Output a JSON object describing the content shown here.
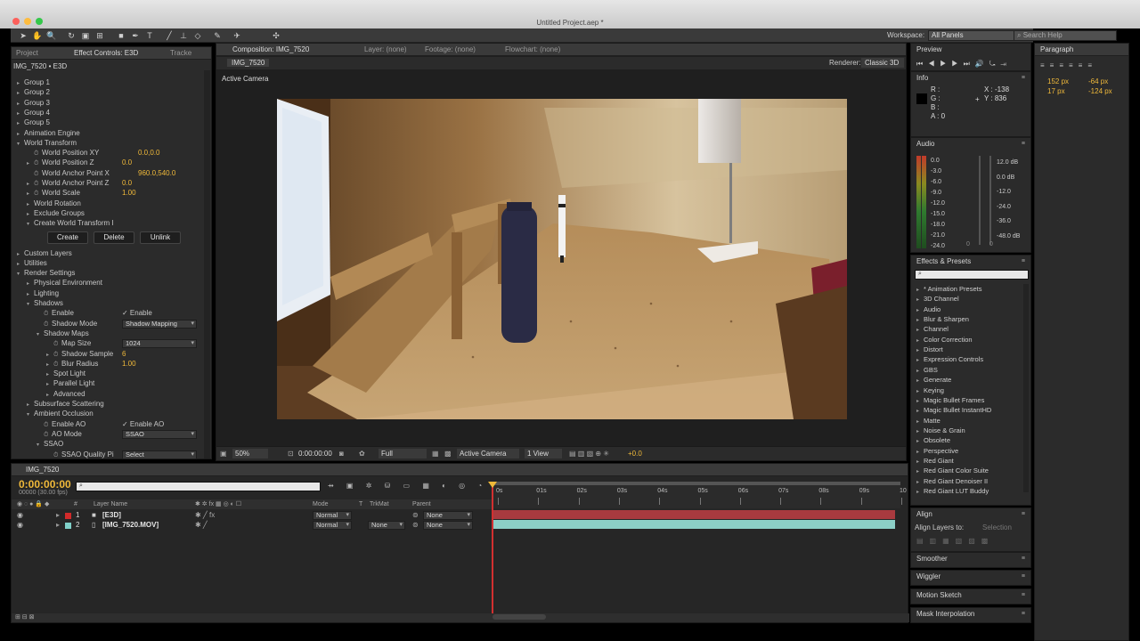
{
  "window": {
    "title": "Untitled Project.aep *"
  },
  "toolbar": {
    "workspace_label": "Workspace:",
    "workspace_value": "All Panels",
    "search_placeholder": "Search Help"
  },
  "left_panel": {
    "tabs": [
      "Project",
      "Effect Controls: E3D",
      "Tracke"
    ],
    "breadcrumb": "IMG_7520 • E3D",
    "rows": [
      {
        "label": "Group 1",
        "indent": 1,
        "tri": "▸"
      },
      {
        "label": "Group 2",
        "indent": 1,
        "tri": "▸"
      },
      {
        "label": "Group 3",
        "indent": 1,
        "tri": "▸"
      },
      {
        "label": "Group 4",
        "indent": 1,
        "tri": "▸"
      },
      {
        "label": "Group 5",
        "indent": 1,
        "tri": "▸"
      },
      {
        "label": "Animation Engine",
        "indent": 1,
        "tri": "▸"
      },
      {
        "label": "World Transform",
        "indent": 1,
        "tri": "▾"
      },
      {
        "label": "World Position XY",
        "indent": 2,
        "sw": true,
        "value": "0.0,0.0"
      },
      {
        "label": "World Position Z",
        "indent": 2,
        "tri": "▸",
        "sw": true,
        "value": "0.0"
      },
      {
        "label": "World Anchor Point X",
        "indent": 2,
        "sw": true,
        "value": "960.0,540.0"
      },
      {
        "label": "World Anchor Point Z",
        "indent": 2,
        "tri": "▸",
        "sw": true,
        "value": "0.0"
      },
      {
        "label": "World Scale",
        "indent": 2,
        "tri": "▸",
        "sw": true,
        "value": "1.00"
      },
      {
        "label": "World Rotation",
        "indent": 2,
        "tri": "▸"
      },
      {
        "label": "Exclude Groups",
        "indent": 2,
        "tri": "▸"
      },
      {
        "label": "Create World Transform I",
        "indent": 2,
        "tri": "▾"
      }
    ],
    "buttons": [
      "Create",
      "Delete",
      "Unlink"
    ],
    "rows2": [
      {
        "label": "Custom Layers",
        "indent": 1,
        "tri": "▸"
      },
      {
        "label": "Utilities",
        "indent": 1,
        "tri": "▸"
      },
      {
        "label": "Render Settings",
        "indent": 1,
        "tri": "▾"
      },
      {
        "label": "Physical Environment",
        "indent": 2,
        "tri": "▸"
      },
      {
        "label": "Lighting",
        "indent": 2,
        "tri": "▸"
      },
      {
        "label": "Shadows",
        "indent": 2,
        "tri": "▾"
      },
      {
        "label": "Enable",
        "indent": 3,
        "sw": true,
        "check": "✓ Enable"
      },
      {
        "label": "Shadow Mode",
        "indent": 3,
        "sw": true,
        "dropdown": "Shadow Mapping"
      },
      {
        "label": "Shadow Maps",
        "indent": 3,
        "tri": "▾"
      },
      {
        "label": "Map Size",
        "indent": 4,
        "sw": true,
        "dropdown": "1024"
      },
      {
        "label": "Shadow Sample",
        "indent": 4,
        "tri": "▸",
        "sw": true,
        "value": "6"
      },
      {
        "label": "Blur Radius",
        "indent": 4,
        "tri": "▸",
        "sw": true,
        "value": "1.00"
      },
      {
        "label": "Spot Light",
        "indent": 4,
        "tri": "▸"
      },
      {
        "label": "Parallel Light",
        "indent": 4,
        "tri": "▸"
      },
      {
        "label": "Advanced",
        "indent": 4,
        "tri": "▸"
      },
      {
        "label": "Subsurface Scattering",
        "indent": 2,
        "tri": "▸"
      },
      {
        "label": "Ambient Occlusion",
        "indent": 2,
        "tri": "▾"
      },
      {
        "label": "Enable AO",
        "indent": 3,
        "sw": true,
        "check": "✓ Enable AO"
      },
      {
        "label": "AO Mode",
        "indent": 3,
        "sw": true,
        "dropdown": "SSAO"
      },
      {
        "label": "SSAO",
        "indent": 3,
        "tri": "▾"
      },
      {
        "label": "SSAO Quality Pi",
        "indent": 4,
        "sw": true,
        "dropdown": "Select"
      }
    ]
  },
  "comp_panel": {
    "tabs": [
      "Composition: IMG_7520",
      "Layer: (none)",
      "Footage: (none)",
      "Flowchart: (none)"
    ],
    "subtab": "IMG_7520",
    "renderer_label": "Renderer:",
    "renderer_value": "Classic 3D",
    "view_label": "Active Camera",
    "footer": {
      "zoom": "50%",
      "time": "0:00:00:00",
      "resolution": "Full",
      "camera": "Active Camera",
      "views": "1 View",
      "exposure": "+0.0"
    }
  },
  "right_panels": {
    "preview": {
      "title": "Preview"
    },
    "info": {
      "title": "Info",
      "channels": [
        "R :",
        "G :",
        "B :",
        "A : 0"
      ],
      "x": "X : -138",
      "y": "Y : 836"
    },
    "audio": {
      "title": "Audio",
      "left_scale": [
        "0.0",
        "-3.0",
        "-6.0",
        "-9.0",
        "-12.0",
        "-15.0",
        "-18.0",
        "-21.0",
        "-24.0"
      ],
      "right_scale": [
        "12.0 dB",
        "0.0 dB",
        "-12.0",
        "-24.0",
        "-36.0",
        "-48.0 dB"
      ],
      "zero_a": "0",
      "zero_b": "0"
    },
    "effects": {
      "title": "Effects & Presets",
      "search_placeholder": "",
      "items": [
        "* Animation Presets",
        "3D Channel",
        "Audio",
        "Blur & Sharpen",
        "Channel",
        "Color Correction",
        "Distort",
        "Expression Controls",
        "GBS",
        "Generate",
        "Keying",
        "Magic Bullet Frames",
        "Magic Bullet InstantHD",
        "Matte",
        "Noise & Grain",
        "Obsolete",
        "Perspective",
        "Red Giant",
        "Red Giant Color Suite",
        "Red Giant Denoiser II",
        "Red Giant LUT Buddy"
      ]
    },
    "align": {
      "title": "Align",
      "label": "Align Layers to:",
      "value": "Selection"
    },
    "smoother": {
      "title": "Smoother"
    },
    "wiggler": {
      "title": "Wiggler"
    },
    "motion_sketch": {
      "title": "Motion Sketch"
    },
    "mask_interpolation": {
      "title": "Mask Interpolation"
    }
  },
  "paragraph_panel": {
    "title": "Paragraph",
    "v1": "152 px",
    "v2": "-64 px",
    "v3": "17 px",
    "v4": "-124 px"
  },
  "timeline": {
    "tab": "IMG_7520",
    "timecode": "0:00:00:00",
    "frames": "00000 (30.00 fps)",
    "headers": {
      "num": "#",
      "layer_name": "Layer Name",
      "mode": "Mode",
      "t": "T",
      "trkmat": "TrkMat",
      "parent": "Parent"
    },
    "layers": [
      {
        "num": "1",
        "name": "[E3D]",
        "color": "#d12a2a",
        "mode": "Normal",
        "trkmat": "",
        "parent": "None"
      },
      {
        "num": "2",
        "name": "[IMG_7520.MOV]",
        "color": "#7fd0c8",
        "mode": "Normal",
        "trkmat": "None",
        "parent": "None"
      }
    ],
    "ruler": [
      "0s",
      "01s",
      "02s",
      "03s",
      "04s",
      "05s",
      "06s",
      "07s",
      "08s",
      "09s",
      "10"
    ]
  }
}
